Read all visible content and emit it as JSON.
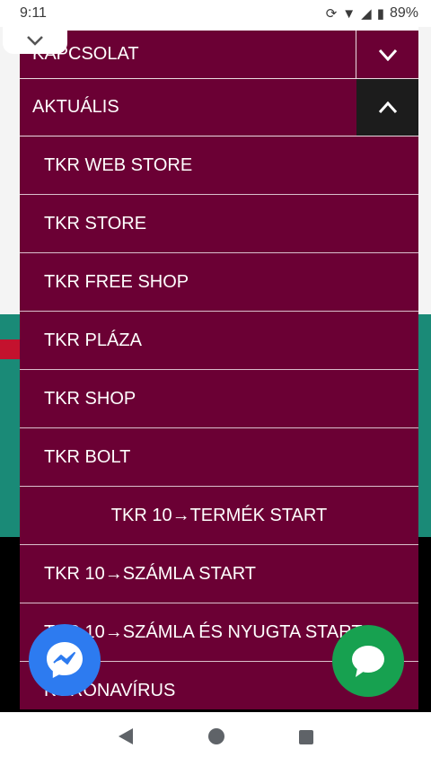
{
  "status_bar": {
    "time": "9:11",
    "battery": "89%",
    "icons": [
      "sync-icon",
      "wifi-icon",
      "signal-icon",
      "battery-icon"
    ]
  },
  "menu": {
    "header_items": [
      {
        "label": "KAPCSOLAT",
        "toggle": "V"
      },
      {
        "label": "AKTUÁLIS",
        "toggle": "Λ"
      }
    ],
    "sub_items": [
      "TKR WEB STORE",
      "TKR STORE",
      "TKR FREE SHOP",
      "TKR PLÁZA",
      "TKR SHOP",
      "TKR BOLT",
      "TKR 10→TERMÉK START",
      "TKR 10→SZÁMLA START",
      "TKR 10→SZÁMLA ÉS NYUGTA START",
      "KORONAVÍRUS"
    ]
  },
  "colors": {
    "menu_bg": "#6b0034",
    "messenger": "#2d7bf0",
    "chat": "#17a150"
  }
}
